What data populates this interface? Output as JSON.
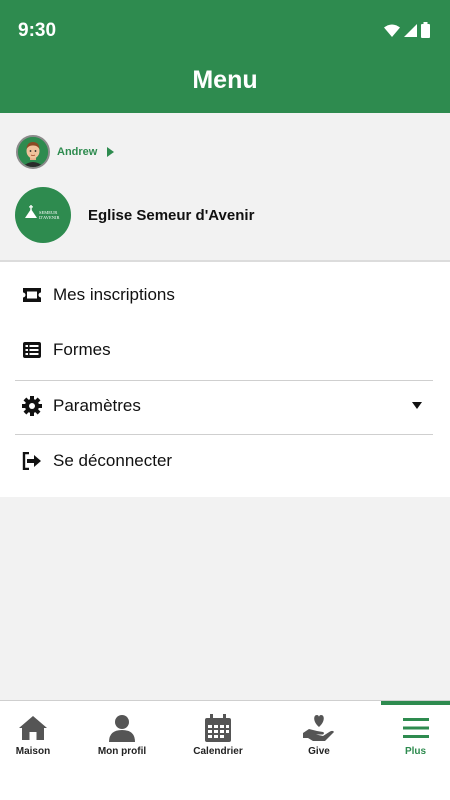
{
  "status_bar": {
    "time": "9:30",
    "icons": [
      "wifi-icon",
      "signal-icon",
      "battery-icon"
    ]
  },
  "header": {
    "title": "Menu",
    "color": "#2e8b4f"
  },
  "user": {
    "name": "Andrew"
  },
  "church": {
    "name": "Eglise Semeur d'Avenir",
    "logo_text": "SEMEUR D'AVENIR"
  },
  "menu": {
    "items": [
      {
        "label": "Mes inscriptions",
        "icon": "ticket-icon"
      },
      {
        "label": "Formes",
        "icon": "list-icon"
      },
      {
        "label": "Paramètres",
        "icon": "gear-icon"
      },
      {
        "label": "Se déconnecter",
        "icon": "logout-icon"
      }
    ]
  },
  "bottom_nav": {
    "items": [
      {
        "label": "Maison",
        "icon": "home-icon"
      },
      {
        "label": "Mon profil",
        "icon": "user-icon"
      },
      {
        "label": "Calendrier",
        "icon": "calendar-icon"
      },
      {
        "label": "Give",
        "icon": "give-icon"
      },
      {
        "label": "Plus",
        "icon": "menu-icon"
      }
    ],
    "active": "Plus"
  }
}
